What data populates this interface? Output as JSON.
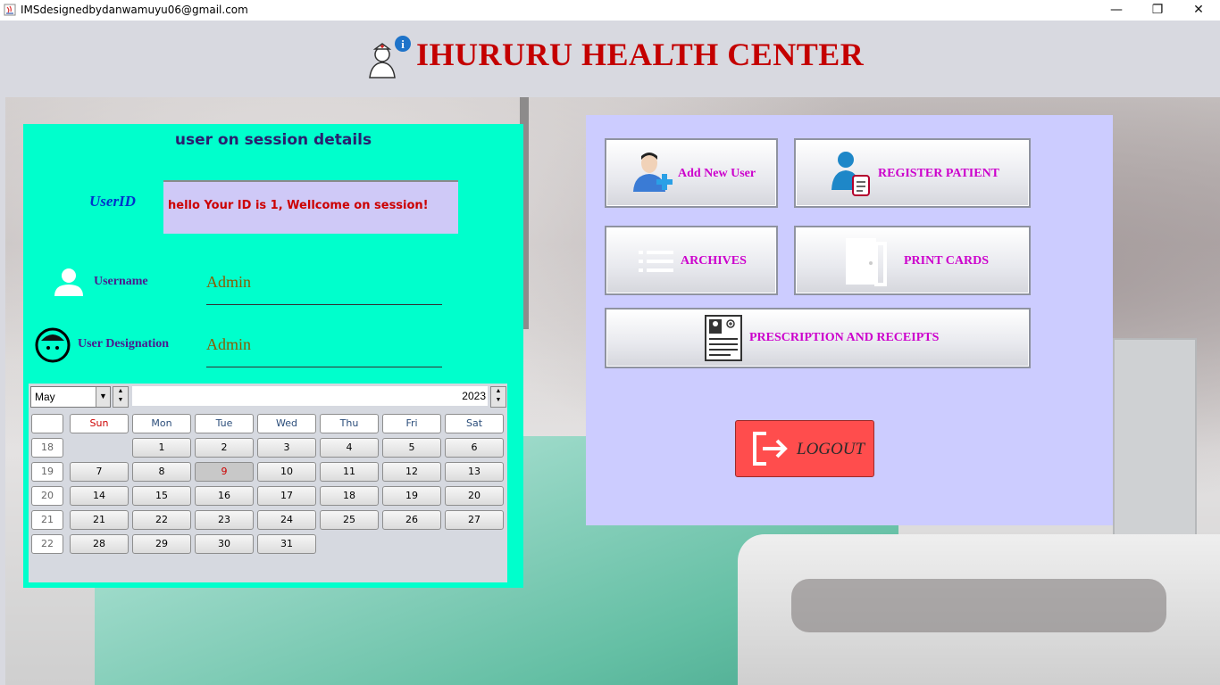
{
  "window": {
    "title": "IMSdesignedbydanwamuyu06@gmail.com",
    "minimize": "—",
    "maximize": "❐",
    "close": "✕"
  },
  "header": {
    "title": "IHURURU HEALTH CENTER",
    "logo_icon": "nurse-info-icon"
  },
  "session": {
    "heading": "user on session details",
    "userid_label": "UserID",
    "userid_message": "hello Your ID is 1,  Wellcome on session!",
    "username_label": "Username",
    "username_value": "Admin",
    "designation_label": "User Designation",
    "designation_value": "Admin"
  },
  "calendar": {
    "month": "May",
    "year": "2023",
    "weekdays": [
      "Sun",
      "Mon",
      "Tue",
      "Wed",
      "Thu",
      "Fri",
      "Sat"
    ],
    "weeks": [
      "18",
      "19",
      "20",
      "21",
      "22"
    ],
    "days": [
      "1",
      "2",
      "3",
      "4",
      "5",
      "6",
      "7",
      "8",
      "9",
      "10",
      "11",
      "12",
      "13",
      "14",
      "15",
      "16",
      "17",
      "18",
      "19",
      "20",
      "21",
      "22",
      "23",
      "24",
      "25",
      "26",
      "27",
      "28",
      "29",
      "30",
      "31"
    ],
    "first_weekday_index": 1,
    "selected_day": "9"
  },
  "actions": {
    "add_user": "Add New User",
    "register_patient": "REGISTER PATIENT",
    "archives": "ARCHIVES",
    "print_cards": "PRINT CARDS",
    "prescription": "PRESCRIPTION AND RECEIPTS",
    "logout": "LOGOUT"
  },
  "colors": {
    "title_red": "#c40000",
    "session_panel": "#00ffcc",
    "actions_panel": "#ccccff",
    "action_label": "#cc00cc",
    "logout_button": "#ff4d4d"
  }
}
